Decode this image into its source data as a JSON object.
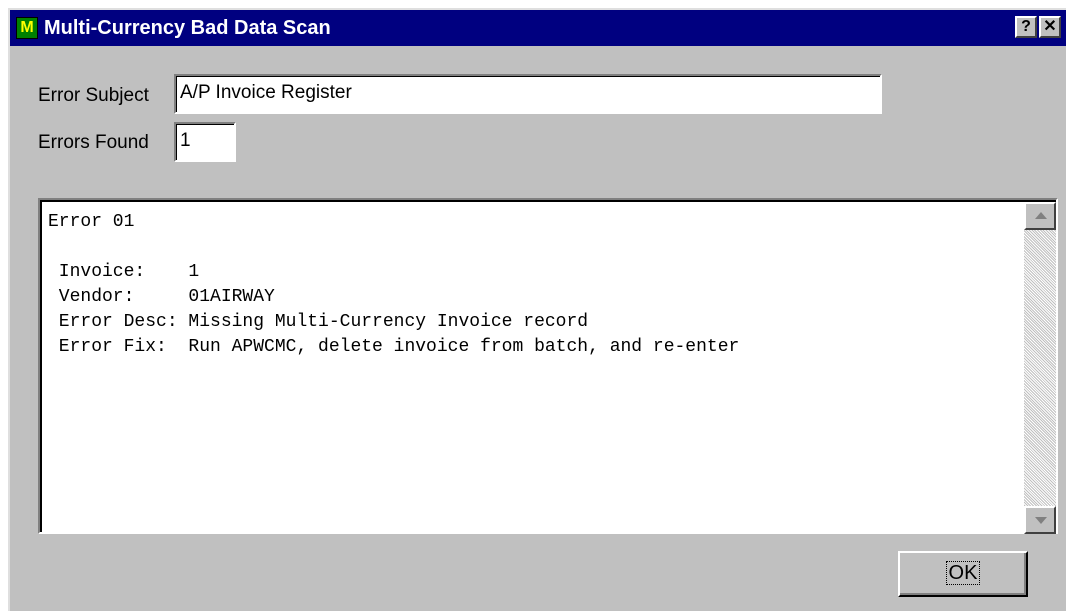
{
  "window": {
    "title": "Multi-Currency Bad Data Scan",
    "app_icon_text": "M",
    "help_button": "?",
    "close_button": "✕"
  },
  "form": {
    "error_subject_label": "Error Subject",
    "error_subject_value": "A/P Invoice Register",
    "errors_found_label": "Errors Found",
    "errors_found_value": "1"
  },
  "report": {
    "text": "Error 01\n\n Invoice:    1\n Vendor:     01AIRWAY\n Error Desc: Missing Multi-Currency Invoice record\n Error Fix:  Run APWCMC, delete invoice from batch, and re-enter"
  },
  "buttons": {
    "ok_label": "OK"
  },
  "colors": {
    "titlebar": "#000080",
    "dialog_face": "#c0c0c0"
  }
}
